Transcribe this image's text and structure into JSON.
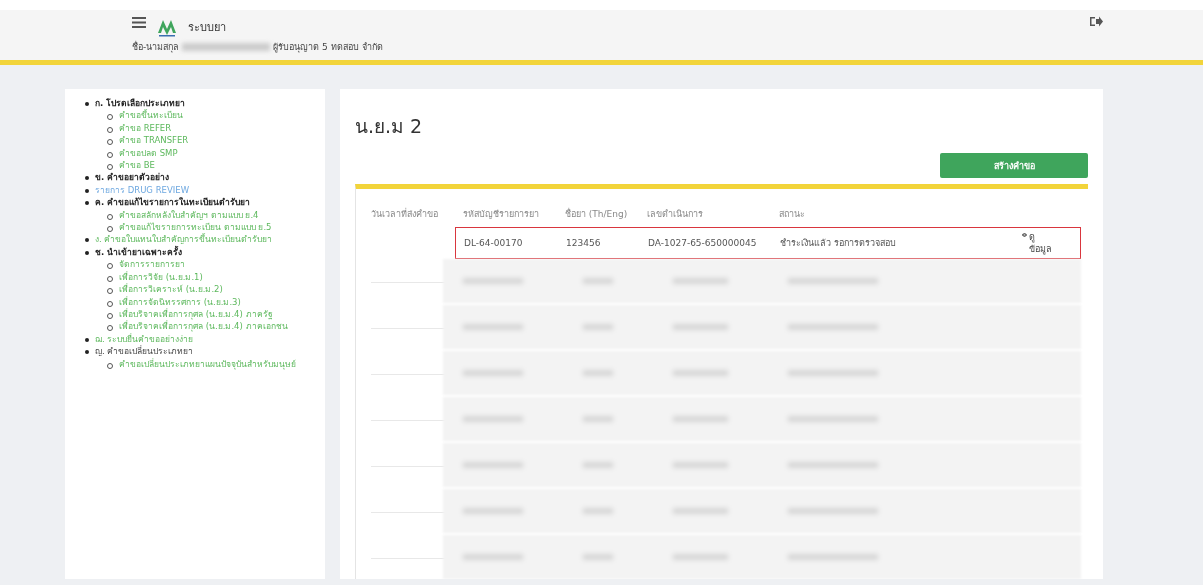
{
  "header": {
    "app_title": "ระบบยา",
    "user_label": "ชื่อ-นามสกุล",
    "user_suffix": "ผู้รับอนุญาต 5 ทดสอบ จำกัด"
  },
  "sidebar": {
    "items": [
      {
        "label": "ก. โปรดเลือกประเภทยา",
        "kind": "heading",
        "children": [
          {
            "label": "คำขอขึ้นทะเบียน",
            "kind": "link"
          },
          {
            "label": "คำขอ REFER",
            "kind": "link"
          },
          {
            "label": "คำขอ TRANSFER",
            "kind": "link"
          },
          {
            "label": "คำขอปลด SMP",
            "kind": "link"
          },
          {
            "label": "คำขอ BE",
            "kind": "link"
          }
        ]
      },
      {
        "label": "ข. คำขอยาตัวอย่าง",
        "kind": "heading"
      },
      {
        "label": "รายการ DRUG REVIEW",
        "kind": "special"
      },
      {
        "label": "ค. คำขอแก้ไขรายการในทะเบียนตำรับยา",
        "kind": "heading",
        "children": [
          {
            "label": "คำขอสลักหลังใบสำคัญฯ ตามแบบ ย.4",
            "kind": "link"
          },
          {
            "label": "คำขอแก้ไขรายการทะเบียน ตามแบบ ย.5",
            "kind": "link"
          }
        ]
      },
      {
        "label": "ง. คำขอใบแทนใบสำคัญการขึ้นทะเบียนตำรับยา",
        "kind": "link"
      },
      {
        "label": "ช. นำเข้ายาเฉพาะครั้ง",
        "kind": "heading",
        "children": [
          {
            "label": "จัดการรายการยา",
            "kind": "link"
          },
          {
            "label": "เพื่อการวิจัย (น.ย.ม.1)",
            "kind": "link"
          },
          {
            "label": "เพื่อการวิเคราะห์ (น.ย.ม.2)",
            "kind": "link"
          },
          {
            "label": "เพื่อการจัดนิทรรศการ (น.ย.ม.3)",
            "kind": "link"
          },
          {
            "label": "เพื่อบริจาคเพื่อการกุศล (น.ย.ม.4) ภาครัฐ",
            "kind": "link"
          },
          {
            "label": "เพื่อบริจาคเพื่อการกุศล (น.ย.ม.4) ภาคเอกชน",
            "kind": "link"
          }
        ]
      },
      {
        "label": "ฌ. ระบบยื่นคำขออย่างง่าย",
        "kind": "link"
      },
      {
        "label": "ญ. คำขอเปลี่ยนประเภทยา",
        "kind": "plain",
        "children": [
          {
            "label": "คำขอเปลี่ยนประเภทยาแผนปัจจุบันสำหรับมนุษย์",
            "kind": "link"
          }
        ]
      }
    ]
  },
  "main": {
    "title": "น.ย.ม 2",
    "create_button": "สร้างคำขอ",
    "table": {
      "columns": [
        "วันเวลาที่ส่งคำขอ",
        "รหัสบัญชีรายการยา",
        "ชื่อยา (Th/Eng)",
        "เลขดำเนินการ",
        "สถานะ",
        ""
      ],
      "rows": [
        {
          "kind": "clear",
          "highlighted": true,
          "cells": [
            "DL-64-00170",
            "123456",
            "DA-1027-65-650000045",
            "ชำระเงินแล้ว รอการตรวจสอบ"
          ],
          "action": "ดูข้อมูล"
        },
        {
          "kind": "blurred"
        },
        {
          "kind": "blurred"
        },
        {
          "kind": "blurred"
        },
        {
          "kind": "blurred"
        },
        {
          "kind": "blurred"
        },
        {
          "kind": "blurred"
        },
        {
          "kind": "blurred"
        }
      ]
    }
  }
}
